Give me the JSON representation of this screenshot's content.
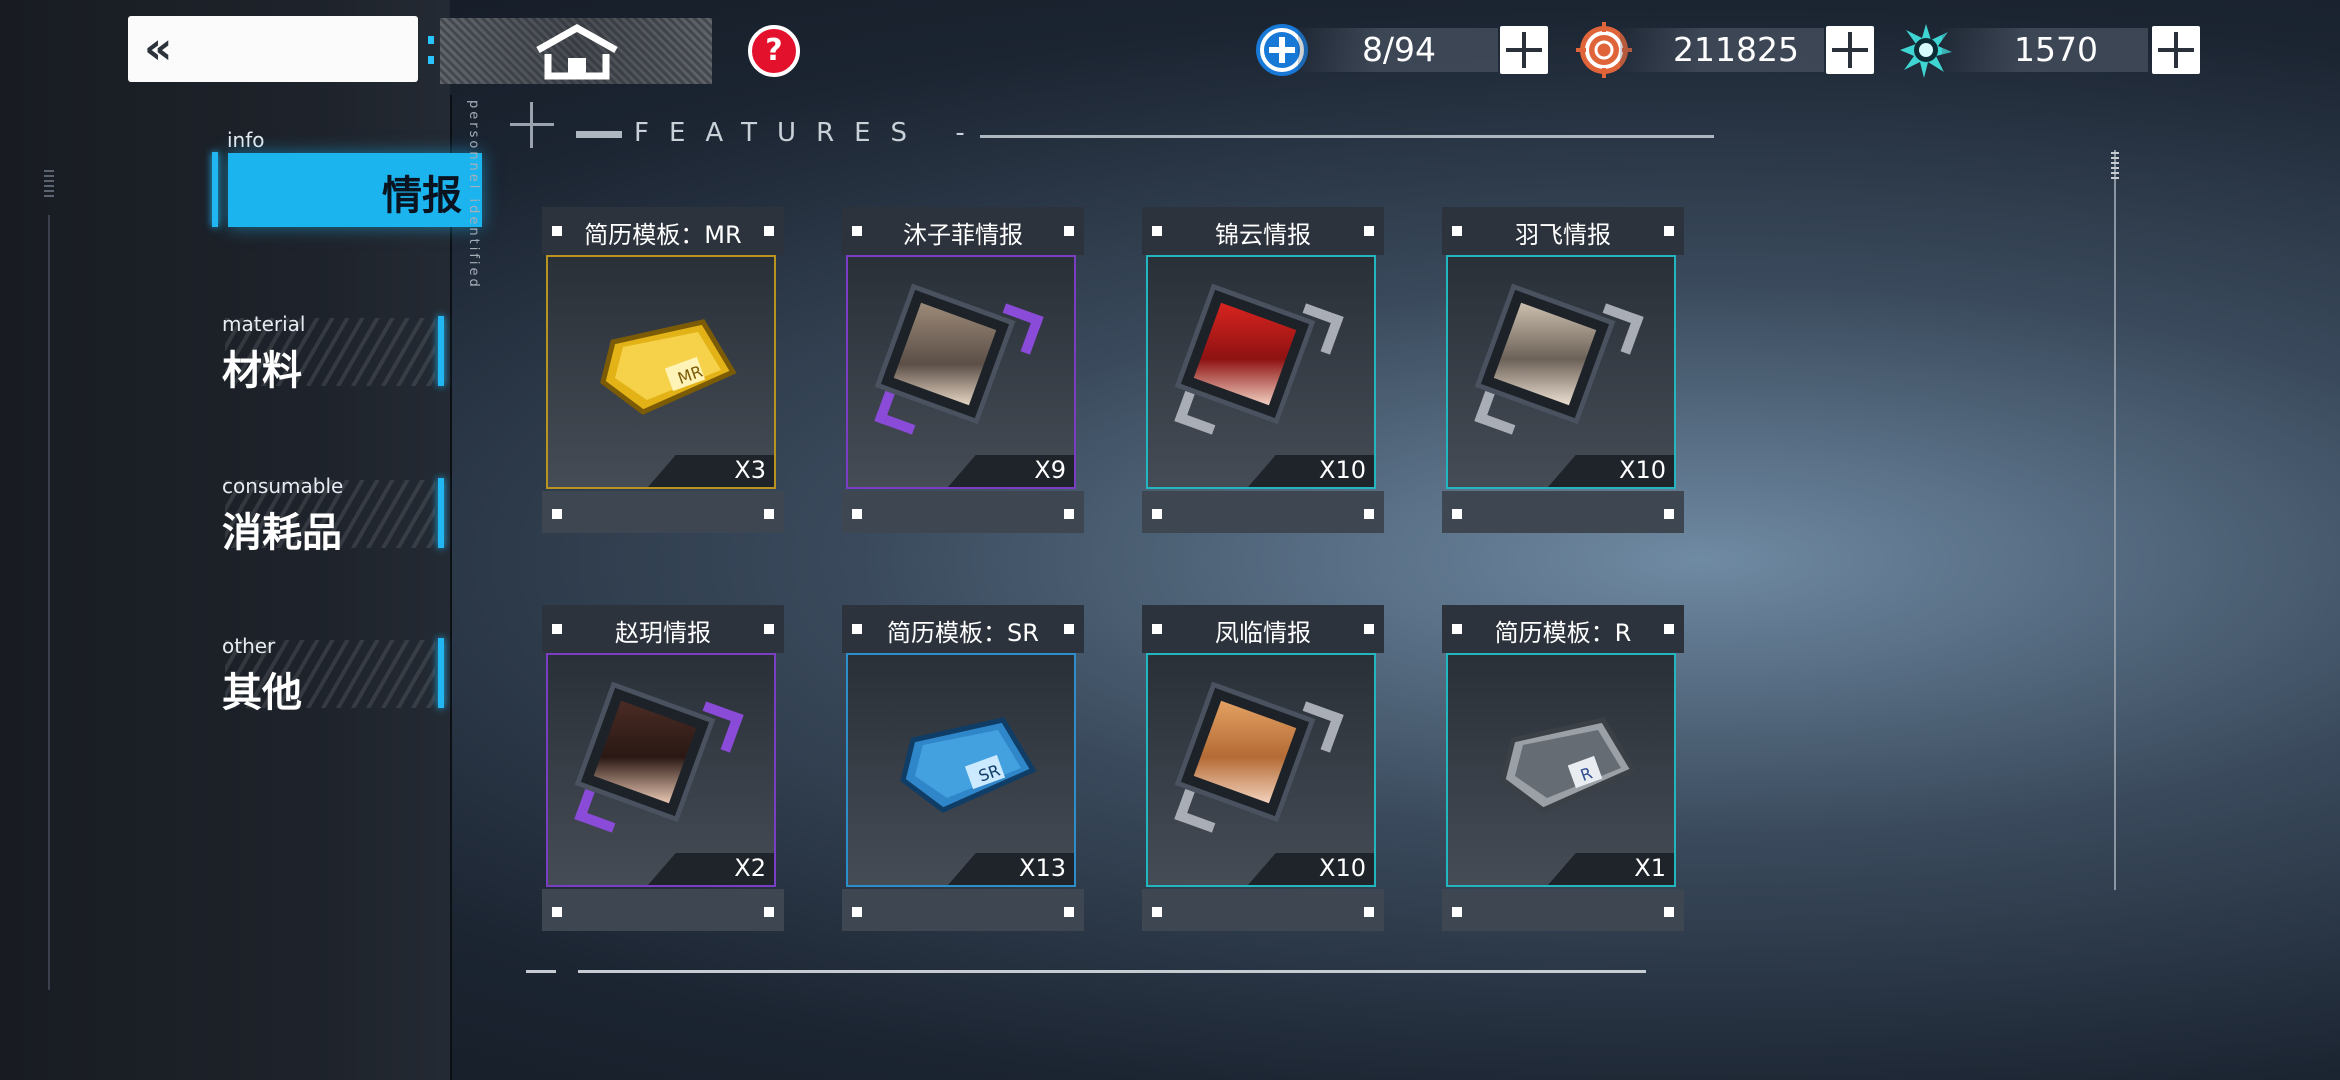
{
  "header": {
    "back_label": "«",
    "help_symbol": "?",
    "resources": [
      {
        "name": "stamina",
        "icon": "blue-plus-circle-icon",
        "value": "8/94"
      },
      {
        "name": "currency",
        "icon": "orange-target-icon",
        "value": "211825"
      },
      {
        "name": "crystal",
        "icon": "teal-burst-icon",
        "value": "1570"
      }
    ]
  },
  "section": {
    "title": "FEATURES -",
    "side_text": "personnel identified"
  },
  "sidebar": {
    "items": [
      {
        "en": "info",
        "zh": "情报",
        "active": true
      },
      {
        "en": "material",
        "zh": "材料",
        "active": false
      },
      {
        "en": "consumable",
        "zh": "消耗品",
        "active": false
      },
      {
        "en": "other",
        "zh": "其他",
        "active": false
      }
    ]
  },
  "items": [
    {
      "name": "简历模板：MR",
      "count": "X3",
      "rarity": "gold",
      "icon": "mr-template-chip-icon"
    },
    {
      "name": "沐子菲情报",
      "count": "X9",
      "rarity": "purple",
      "icon": "portrait-intel-icon"
    },
    {
      "name": "锦云情报",
      "count": "X10",
      "rarity": "teal",
      "icon": "portrait-intel-icon"
    },
    {
      "name": "羽飞情报",
      "count": "X10",
      "rarity": "teal",
      "icon": "portrait-intel-icon"
    },
    {
      "name": "赵玥情报",
      "count": "X2",
      "rarity": "purple",
      "icon": "portrait-intel-icon"
    },
    {
      "name": "简历模板：SR",
      "count": "X13",
      "rarity": "blue",
      "icon": "sr-template-chip-icon"
    },
    {
      "name": "凤临情报",
      "count": "X10",
      "rarity": "teal",
      "icon": "portrait-intel-icon"
    },
    {
      "name": "简历模板：R",
      "count": "X1",
      "rarity": "teal",
      "icon": "r-template-chip-icon"
    }
  ],
  "colors": {
    "accent": "#1cb4ee",
    "help": "#e3112c",
    "gold": "#b9931f",
    "purple": "#7a3ec3",
    "teal": "#23b6bf"
  }
}
